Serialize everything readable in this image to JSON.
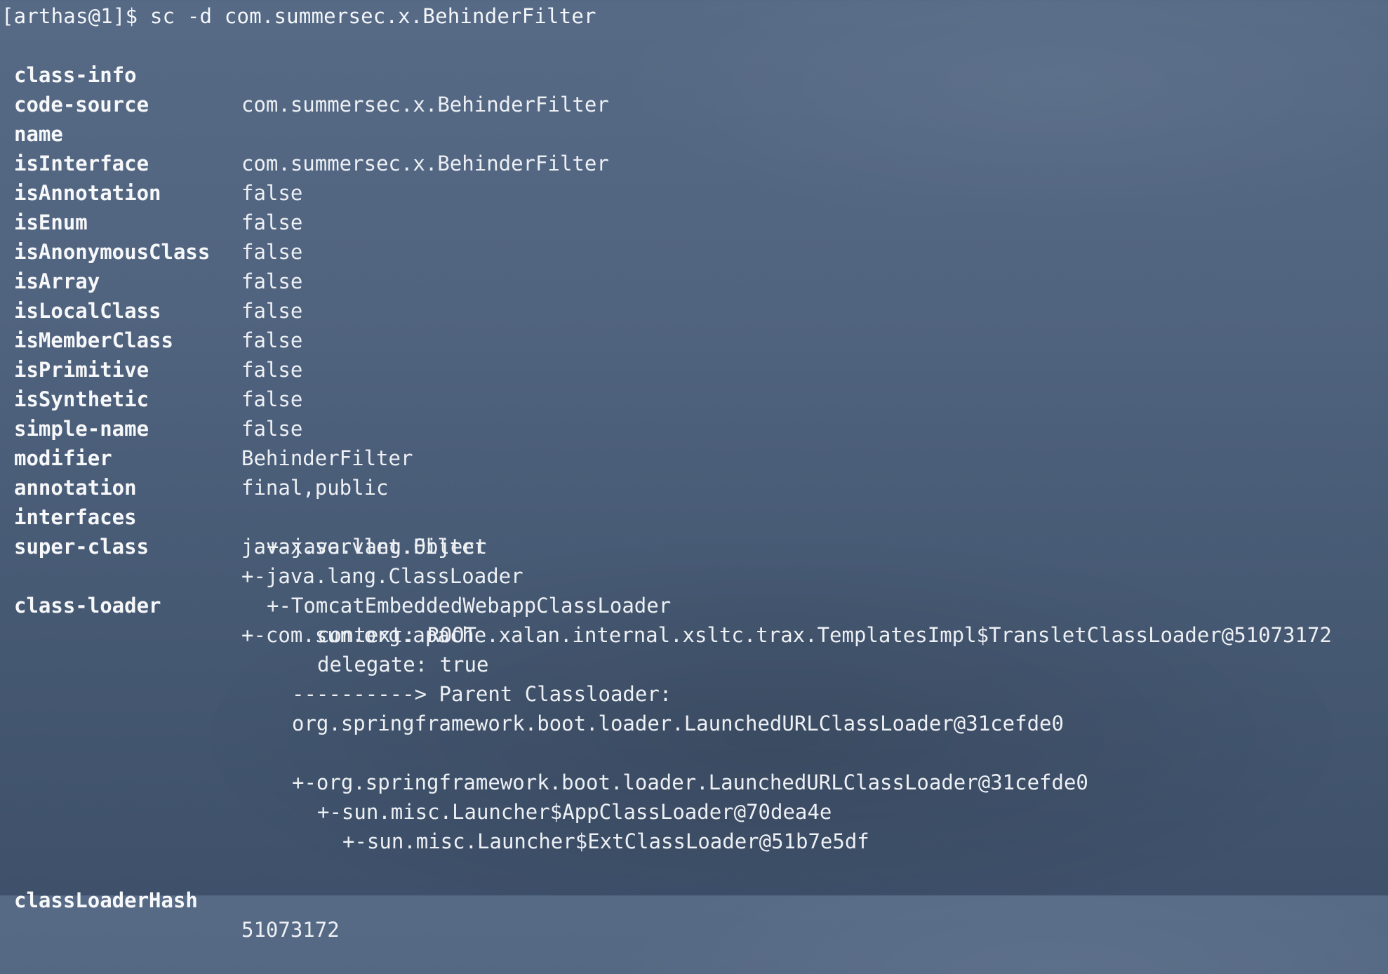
{
  "prompt": "[arthas@1]$ sc -d com.summersec.x.BehinderFilter",
  "fields": [
    {
      "key": "class-info",
      "value": "com.summersec.x.BehinderFilter"
    },
    {
      "key": "code-source",
      "value": ""
    },
    {
      "key": "name",
      "value": "com.summersec.x.BehinderFilter"
    },
    {
      "key": "isInterface",
      "value": "false"
    },
    {
      "key": "isAnnotation",
      "value": "false"
    },
    {
      "key": "isEnum",
      "value": "false"
    },
    {
      "key": "isAnonymousClass",
      "value": "false"
    },
    {
      "key": "isArray",
      "value": "false"
    },
    {
      "key": "isLocalClass",
      "value": "false"
    },
    {
      "key": "isMemberClass",
      "value": "false"
    },
    {
      "key": "isPrimitive",
      "value": "false"
    },
    {
      "key": "isSynthetic",
      "value": "false"
    },
    {
      "key": "simple-name",
      "value": "BehinderFilter"
    },
    {
      "key": "modifier",
      "value": "final,public"
    },
    {
      "key": "annotation",
      "value": ""
    },
    {
      "key": "interfaces",
      "value": "javax.servlet.Filter"
    },
    {
      "key": "super-class",
      "value": "+-java.lang.ClassLoader"
    }
  ],
  "super_class_tree": [
    "+-java.lang.Object"
  ],
  "class_loader": {
    "key": "class-loader",
    "lines": [
      "+-com.sun.org.apache.xalan.internal.xsltc.trax.TemplatesImpl$TransletClassLoader@51073172",
      "+-TomcatEmbeddedWebappClassLoader",
      "context: ROOT",
      "delegate: true",
      "----------> Parent Classloader:",
      "org.springframework.boot.loader.LaunchedURLClassLoader@31cefde0",
      "+-org.springframework.boot.loader.LaunchedURLClassLoader@31cefde0",
      "+-sun.misc.Launcher$AppClassLoader@70dea4e",
      "+-sun.misc.Launcher$ExtClassLoader@51b7e5df"
    ]
  },
  "class_loader_hash": {
    "key": "classLoaderHash",
    "value": "51073172"
  }
}
